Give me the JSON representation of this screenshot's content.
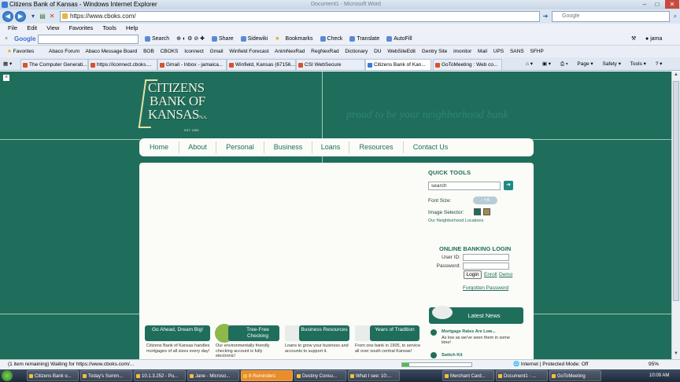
{
  "window": {
    "title": "Citizens Bank of Kansas - Windows Internet Explorer",
    "ghost_title": "Document1 - Microsoft Word",
    "min": "–",
    "max": "□",
    "close": "✕"
  },
  "address": {
    "url": "https://www.cboks.com/",
    "search_placeholder": "Google",
    "back": "◀",
    "forward": "▶"
  },
  "menu": [
    "File",
    "Edit",
    "View",
    "Favorites",
    "Tools",
    "Help"
  ],
  "google_toolbar": {
    "close": "×",
    "logo": "Google",
    "items": [
      "Search",
      "Share",
      "Sidewiki",
      "Bookmarks",
      "Check",
      "Translate",
      "AutoFill"
    ],
    "user": "jama"
  },
  "favorites": {
    "label": "Favorites",
    "items": [
      "Abaco Forum",
      "Abaco Message Board",
      "BOB",
      "CBOKS",
      "Iconnect",
      "Gmail",
      "Winfield Forecast",
      "AnimNexRad",
      "RegNexRad",
      "Dictionary",
      "DU",
      "WebSiteEdit",
      "Gentry Site",
      "imonitor",
      "Mail",
      "UPS",
      "SANS",
      "SFHP"
    ]
  },
  "tabs": [
    {
      "label": "The Computer Generati..."
    },
    {
      "label": "https://iconnect.cboks...."
    },
    {
      "label": "Gmail - Inbox - jamaica..."
    },
    {
      "label": "Winfield, Kansas (67156..."
    },
    {
      "label": "CSI WebSecure"
    },
    {
      "label": "Citizens Bank of Kan..."
    },
    {
      "label": "GoToMeeting : Web co..."
    }
  ],
  "tab_tools": [
    "Page ▾",
    "Safety ▾",
    "Tools ▾"
  ],
  "site": {
    "logo_lines": [
      "CITIZENS",
      "BANK OF",
      "KANSAS"
    ],
    "logo_sub": "N.A.",
    "logo_est": "EST. 1905",
    "tagline": "proud to be your neighborhood bank",
    "nav": [
      "Home",
      "About",
      "Personal",
      "Business",
      "Loans",
      "Resources",
      "Contact Us"
    ],
    "quick_tools": {
      "title": "QUICK TOOLS",
      "search_value": "search",
      "go": "➔",
      "font_size_label": "Font Size:",
      "font_btns": "- +A",
      "image_selector_label": "Image Selector:",
      "swatch_colors": [
        "#1f6e5b",
        "#a08a4e"
      ],
      "neighborhood_link": "Our Neighborhood Locations"
    },
    "online_banking": {
      "title": "ONLINE BANKING LOGIN",
      "user_id_label": "User ID:",
      "password_label": "Password:",
      "login": "Login",
      "enroll": "Enroll",
      "demo": "Demo",
      "forgotten": "Forgotten Password"
    },
    "features": [
      {
        "title": "Go Ahead, Dream Big!",
        "desc": "Citizens Bank of Kansas handles mortgages of all sizes every day!"
      },
      {
        "title": "Tree-Free Checking",
        "desc": "Our environmentally friendly checking account is fully electronic!"
      },
      {
        "title": "Business Resources",
        "desc": "Loans to grow your business and accounts to support it."
      },
      {
        "title": "Years of Tradition",
        "desc": "From one bank in 1905, to service all over south central Kansas!"
      }
    ],
    "news": {
      "title": "Latest News",
      "items": [
        {
          "title": "Mortgage Rates Are Low...",
          "sub": "As low as we've seen them in some time!"
        },
        {
          "title": "Switch Kit",
          "sub": ""
        }
      ]
    }
  },
  "status": {
    "text": "(1 item remaining) Waiting for https://www.cboks.com/...",
    "progress": 0.1,
    "zone": "Internet | Protected Mode: Off",
    "zoom": "95%"
  },
  "taskbar": {
    "items": [
      "Citizens Bank o...",
      "Today's Summ...",
      "10.1.3.252 - Pu...",
      "Jane - Microso...",
      "8 Reminders",
      "Destiny Consu...",
      "What I see: 10:...",
      "Merchant Card...",
      "Document1 - ...",
      "GoToMeeting"
    ],
    "clock": "10:09 AM"
  }
}
